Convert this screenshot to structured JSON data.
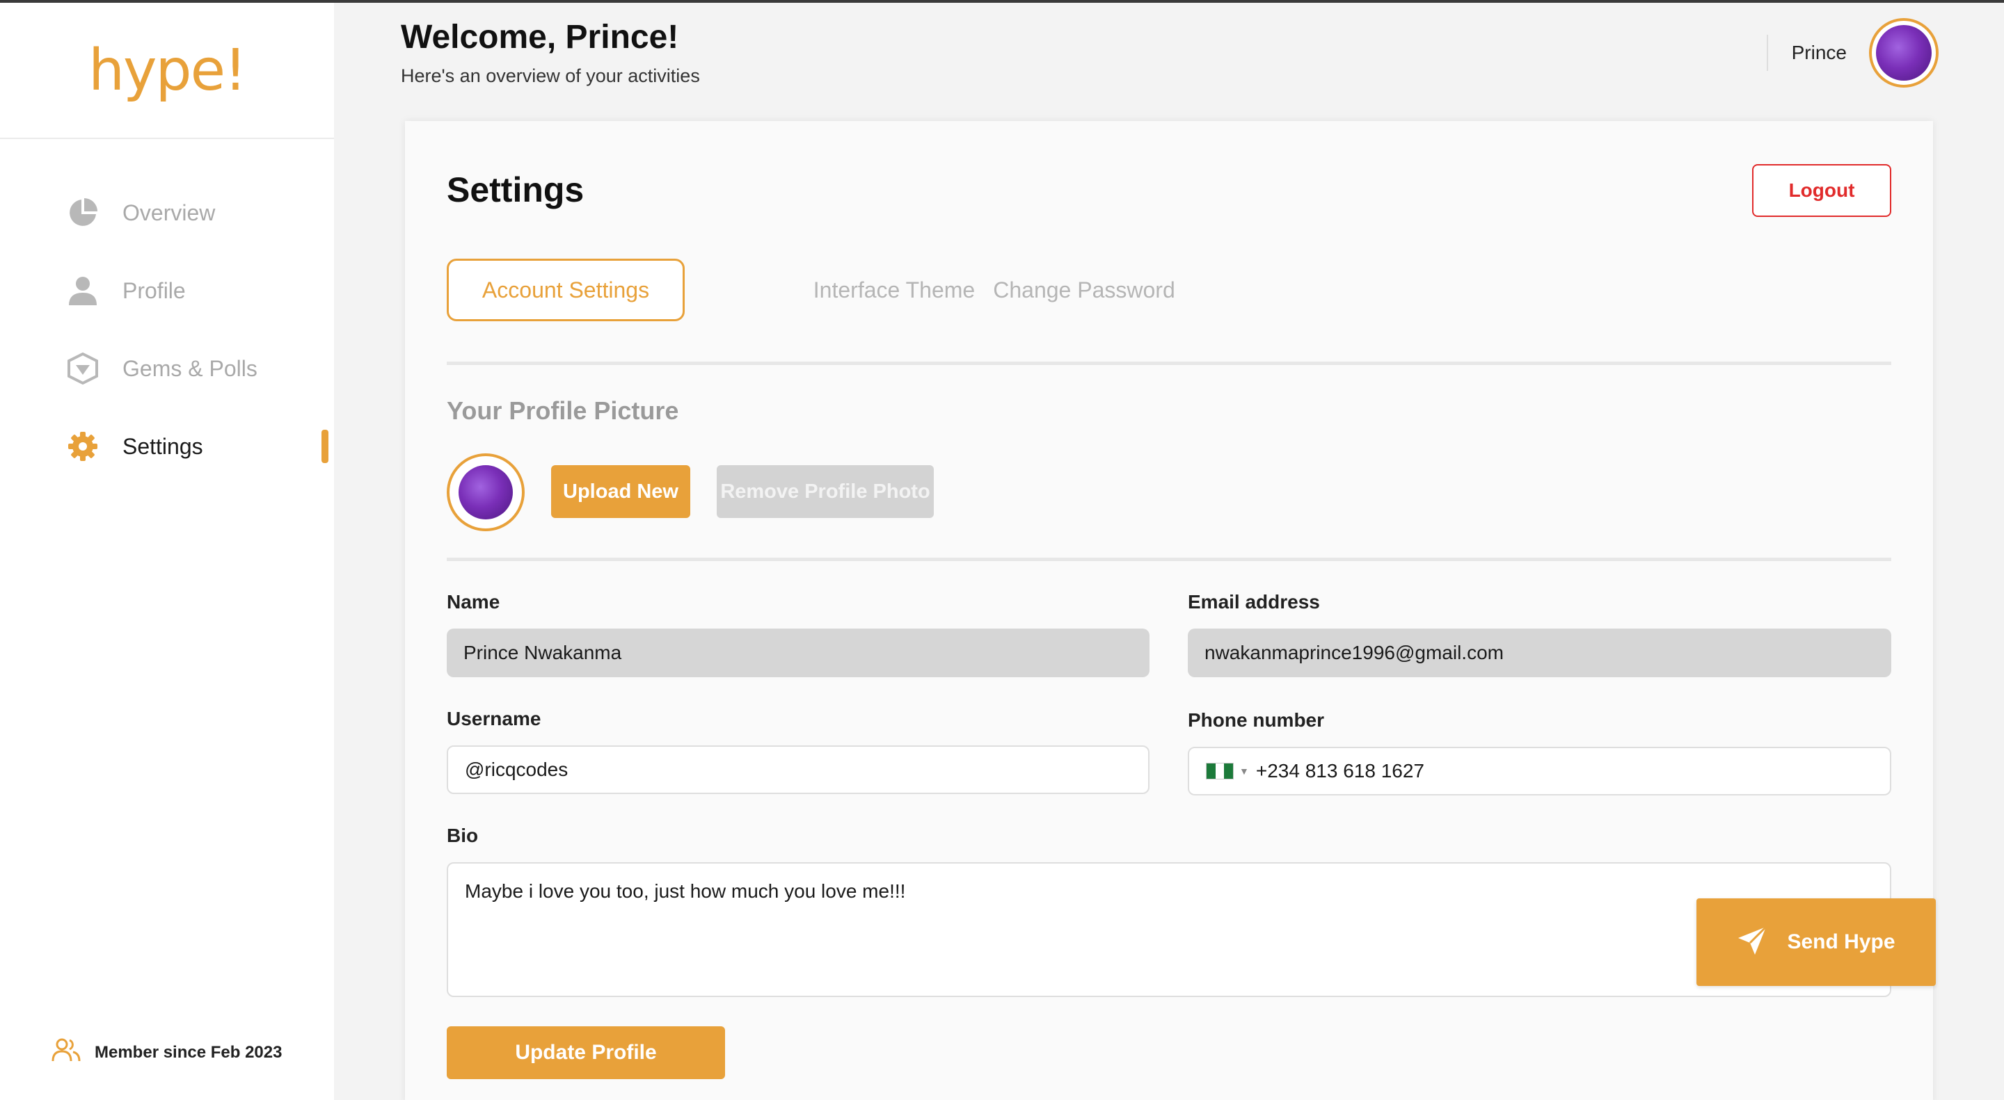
{
  "brand": {
    "logo_text": "hype!",
    "accent_color": "#e8a13a"
  },
  "sidebar": {
    "items": [
      {
        "label": "Overview",
        "icon": "pie-chart-icon",
        "active": false
      },
      {
        "label": "Profile",
        "icon": "user-icon",
        "active": false
      },
      {
        "label": "Gems & Polls",
        "icon": "gem-icon",
        "active": false
      },
      {
        "label": "Settings",
        "icon": "gear-icon",
        "active": true
      }
    ],
    "member_since": "Member since Feb 2023"
  },
  "header": {
    "title": "Welcome, Prince!",
    "subtitle": "Here's an overview of your activities",
    "user_name": "Prince"
  },
  "settings": {
    "title": "Settings",
    "logout_label": "Logout",
    "tabs": [
      {
        "label": "Account Settings",
        "active": true
      },
      {
        "label": "Interface Theme",
        "active": false
      },
      {
        "label": "Change Password",
        "active": false
      }
    ],
    "profile_picture": {
      "title": "Your Profile Picture",
      "upload_label": "Upload New",
      "remove_label": "Remove Profile Photo"
    },
    "form": {
      "name_label": "Name",
      "name_value": "Prince Nwakanma",
      "email_label": "Email address",
      "email_value": "nwakanmaprince1996@gmail.com",
      "username_label": "Username",
      "username_value": "@ricqcodes",
      "phone_label": "Phone number",
      "phone_value": "+234 813 618 1627",
      "phone_country_icon": "nigeria-flag-icon",
      "bio_label": "Bio",
      "bio_value": "Maybe i love you too, just how much you love me!!!",
      "update_label": "Update Profile"
    }
  },
  "floating": {
    "send_hype_label": "Send Hype"
  },
  "colors": {
    "logout_red": "#e12b2b",
    "muted_button": "#d3d3d3"
  }
}
